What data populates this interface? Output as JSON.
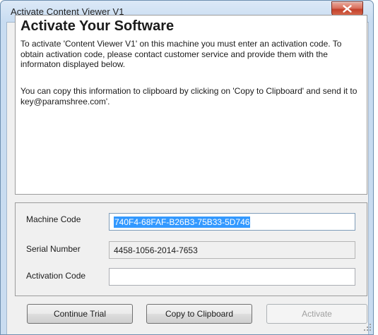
{
  "window": {
    "title": "Activate Content Viewer V1",
    "close_icon": "close-x-icon"
  },
  "info": {
    "heading": "Activate Your Software",
    "paragraph_1": "To activate 'Content Viewer V1' on this machine you must enter an activation code. To obtain activation code, please contact customer service and provide them with the informaton displayed below.",
    "paragraph_2": "You can copy this information to clipboard by clicking on 'Copy to Clipboard' and send it to key@paramshree.com'."
  },
  "fields": {
    "machine_code_label": "Machine Code",
    "machine_code_value": "740F4-68FAF-B26B3-75B33-5D746",
    "serial_number_label": "Serial Number",
    "serial_number_value": "4458-1056-2014-7653",
    "activation_code_label": "Activation Code",
    "activation_code_value": ""
  },
  "buttons": {
    "continue_trial": "Continue Trial",
    "copy_to_clipboard": "Copy to Clipboard",
    "activate": "Activate"
  },
  "colors": {
    "selection": "#3399ff",
    "close_button": "#c3412b"
  }
}
